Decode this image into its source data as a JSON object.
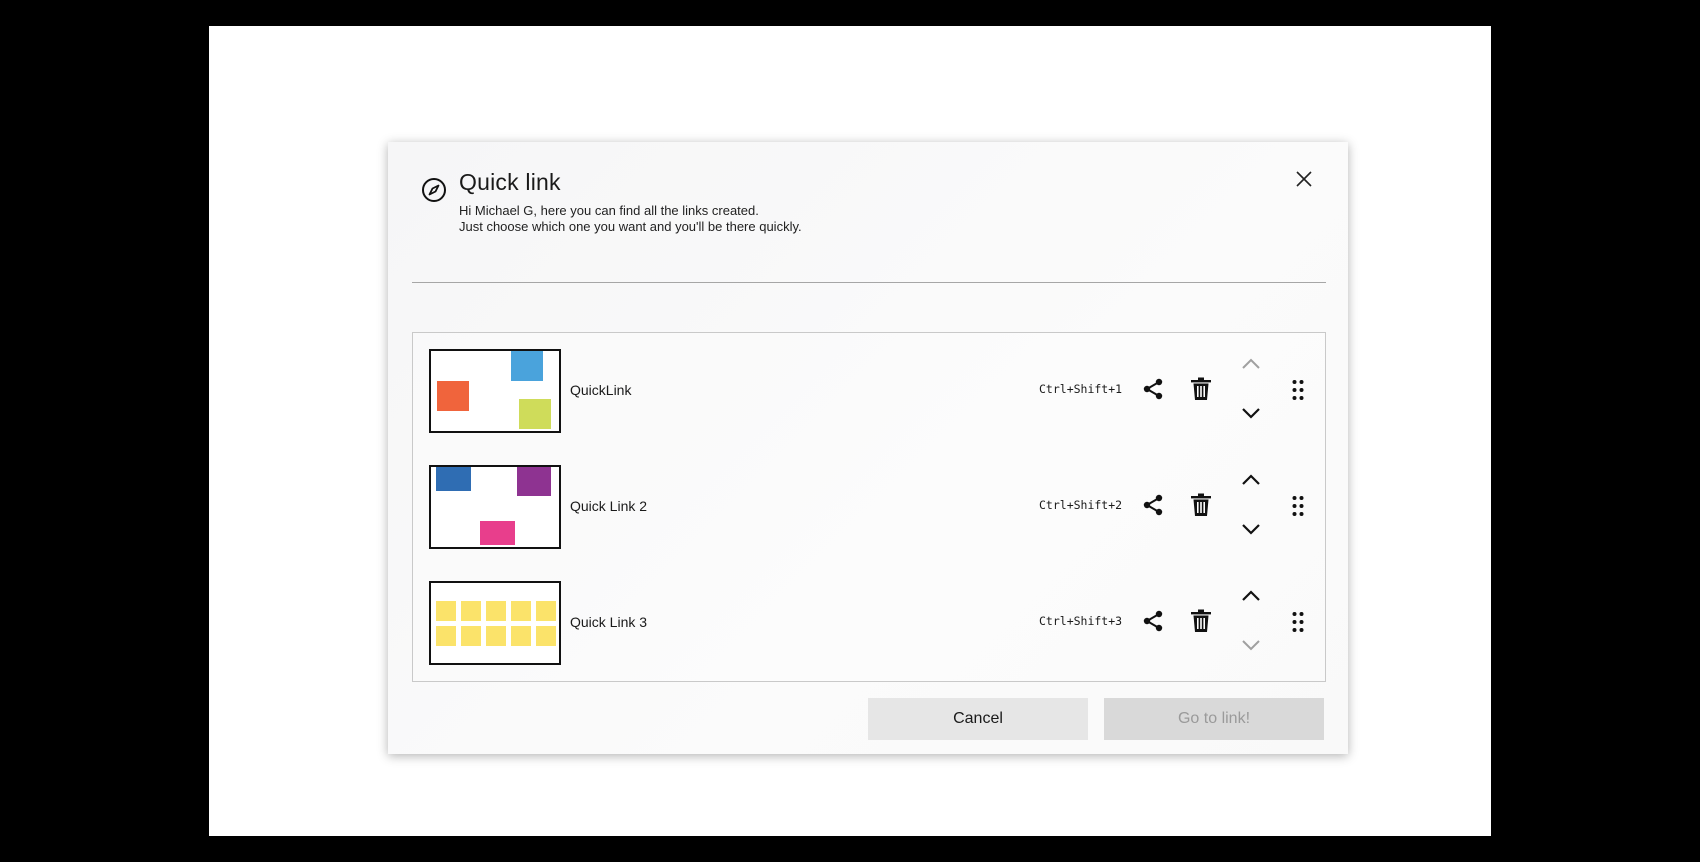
{
  "dialog": {
    "title": "Quick link",
    "subtitle_line1": "Hi Michael G, here you can find all the links created.",
    "subtitle_line2": "Just choose which one you want and you'll be there quickly.",
    "icons": {
      "header": "compass-icon",
      "close": "close-icon"
    }
  },
  "links": [
    {
      "label": "QuickLink",
      "shortcut": "Ctrl+Shift+1",
      "move_up_enabled": false,
      "move_down_enabled": true,
      "thumbnail_notes": [
        {
          "color": "#f0643c"
        },
        {
          "color": "#4aa3dc"
        },
        {
          "color": "#cfdc5a"
        }
      ]
    },
    {
      "label": "Quick Link 2",
      "shortcut": "Ctrl+Shift+2",
      "move_up_enabled": true,
      "move_down_enabled": true,
      "thumbnail_notes": [
        {
          "color": "#2f6db3"
        },
        {
          "color": "#8e3391"
        },
        {
          "color": "#e83e8c"
        }
      ]
    },
    {
      "label": "Quick Link 3",
      "shortcut": "Ctrl+Shift+3",
      "move_up_enabled": true,
      "move_down_enabled": false,
      "thumbnail_notes": [
        {
          "color": "#fbe36a"
        }
      ]
    }
  ],
  "row_icons": [
    "share-icon",
    "trash-icon",
    "chevron-up-icon",
    "chevron-down-icon",
    "drag-handle-icon"
  ],
  "footer": {
    "cancel_label": "Cancel",
    "go_label": "Go to link!",
    "go_enabled": false
  },
  "colors": {
    "backdrop": "#000000",
    "dialog_bg": "#f8f8f8",
    "disabled_button_text": "#9a9a9a"
  }
}
